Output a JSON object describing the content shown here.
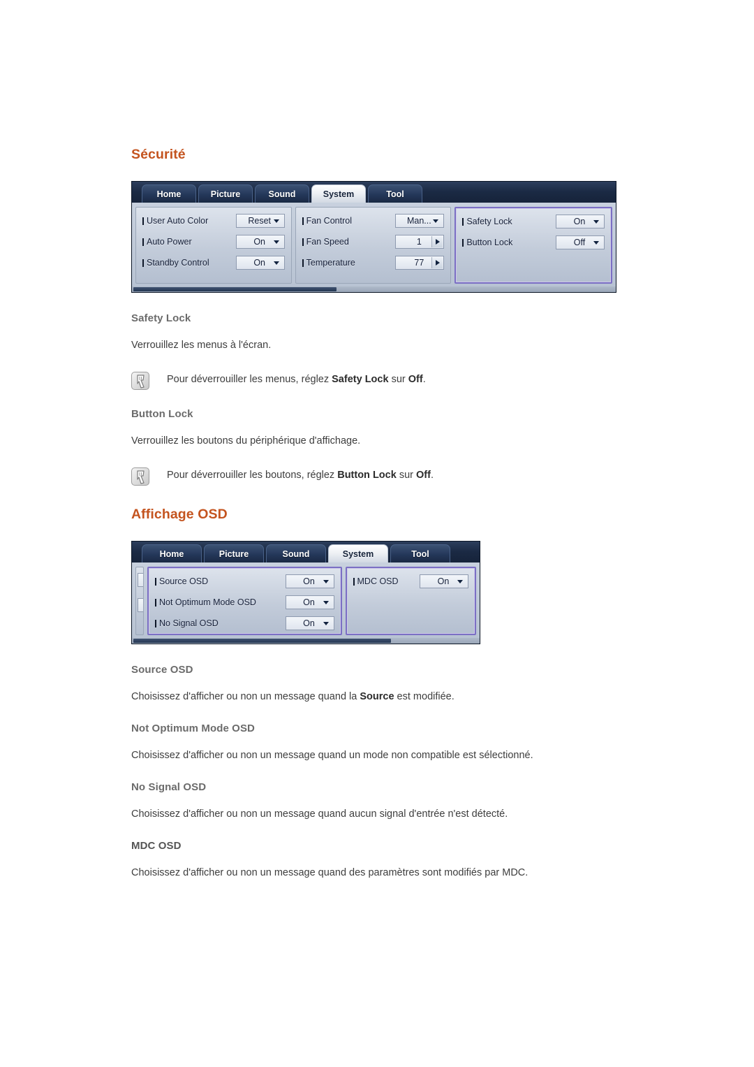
{
  "page": {
    "sections": [
      {
        "id": "securite",
        "title": "Sécurité"
      },
      {
        "id": "affichage-osd",
        "title": "Affichage OSD"
      }
    ]
  },
  "osd_security": {
    "tabs": [
      {
        "label": "Home",
        "active": false
      },
      {
        "label": "Picture",
        "active": false
      },
      {
        "label": "Sound",
        "active": false
      },
      {
        "label": "System",
        "active": true
      },
      {
        "label": "Tool",
        "active": false
      }
    ],
    "columns": [
      {
        "highlighted": false,
        "rows": [
          {
            "label": "User Auto Color",
            "value": "Reset",
            "control": "dropdown"
          },
          {
            "label": "Auto Power",
            "value": "On",
            "control": "dropdown"
          },
          {
            "label": "Standby Control",
            "value": "On",
            "control": "dropdown"
          }
        ]
      },
      {
        "highlighted": false,
        "rows": [
          {
            "label": "Fan Control",
            "value": "Man...",
            "control": "dropdown"
          },
          {
            "label": "Fan Speed",
            "value": "1",
            "control": "stepper"
          },
          {
            "label": "Temperature",
            "value": "77",
            "control": "stepper"
          }
        ]
      },
      {
        "highlighted": true,
        "rows": [
          {
            "label": "Safety Lock",
            "value": "On",
            "control": "dropdown"
          },
          {
            "label": "Button Lock",
            "value": "Off",
            "control": "dropdown"
          }
        ]
      }
    ]
  },
  "osd_display": {
    "tabs": [
      {
        "label": "Home",
        "active": false
      },
      {
        "label": "Picture",
        "active": false
      },
      {
        "label": "Sound",
        "active": false
      },
      {
        "label": "System",
        "active": true
      },
      {
        "label": "Tool",
        "active": false
      }
    ],
    "columns": [
      {
        "highlighted": true,
        "rows": [
          {
            "label": "Source OSD",
            "value": "On",
            "control": "dropdown"
          },
          {
            "label": "Not Optimum Mode OSD",
            "value": "On",
            "control": "dropdown"
          },
          {
            "label": "No Signal OSD",
            "value": "On",
            "control": "dropdown"
          }
        ]
      },
      {
        "highlighted": true,
        "rows": [
          {
            "label": "MDC OSD",
            "value": "On",
            "control": "dropdown"
          }
        ]
      }
    ]
  },
  "security_topics": [
    {
      "heading": "Safety Lock",
      "body": "Verrouillez les menus à l'écran.",
      "note": {
        "prefix": "Pour déverrouiller les menus, réglez ",
        "bold1": "Safety Lock",
        "middle": " sur ",
        "bold2": "Off",
        "suffix": "."
      }
    },
    {
      "heading": "Button Lock",
      "body": "Verrouillez les boutons du périphérique d'affichage.",
      "note": {
        "prefix": "Pour déverrouiller les boutons, réglez ",
        "bold1": "Button Lock",
        "middle": " sur ",
        "bold2": "Off",
        "suffix": "."
      }
    }
  ],
  "osd_topics": [
    {
      "heading": "Source OSD",
      "body_prefix": "Choisissez d'afficher ou non un message quand la ",
      "body_bold": "Source",
      "body_suffix": " est modifiée."
    },
    {
      "heading": "Not Optimum Mode OSD",
      "body_prefix": "Choisissez d'afficher ou non un message quand un mode non compatible est sélectionné.",
      "body_bold": "",
      "body_suffix": ""
    },
    {
      "heading": "No Signal OSD",
      "body_prefix": "Choisissez d'afficher ou non un message quand aucun signal d'entrée n'est détecté.",
      "body_bold": "",
      "body_suffix": ""
    },
    {
      "heading": "MDC OSD",
      "body_prefix": "Choisissez d'afficher ou non un message quand des paramètres sont modifiés par MDC.",
      "body_bold": "",
      "body_suffix": ""
    }
  ],
  "colors": {
    "heading_orange": "#c4541f",
    "subheading_grey": "#6b6b6b",
    "body_grey": "#3d3d3d",
    "osd_highlight_purple": "#7b6fc4",
    "osd_tabbar_dark": "#1b2a44"
  }
}
